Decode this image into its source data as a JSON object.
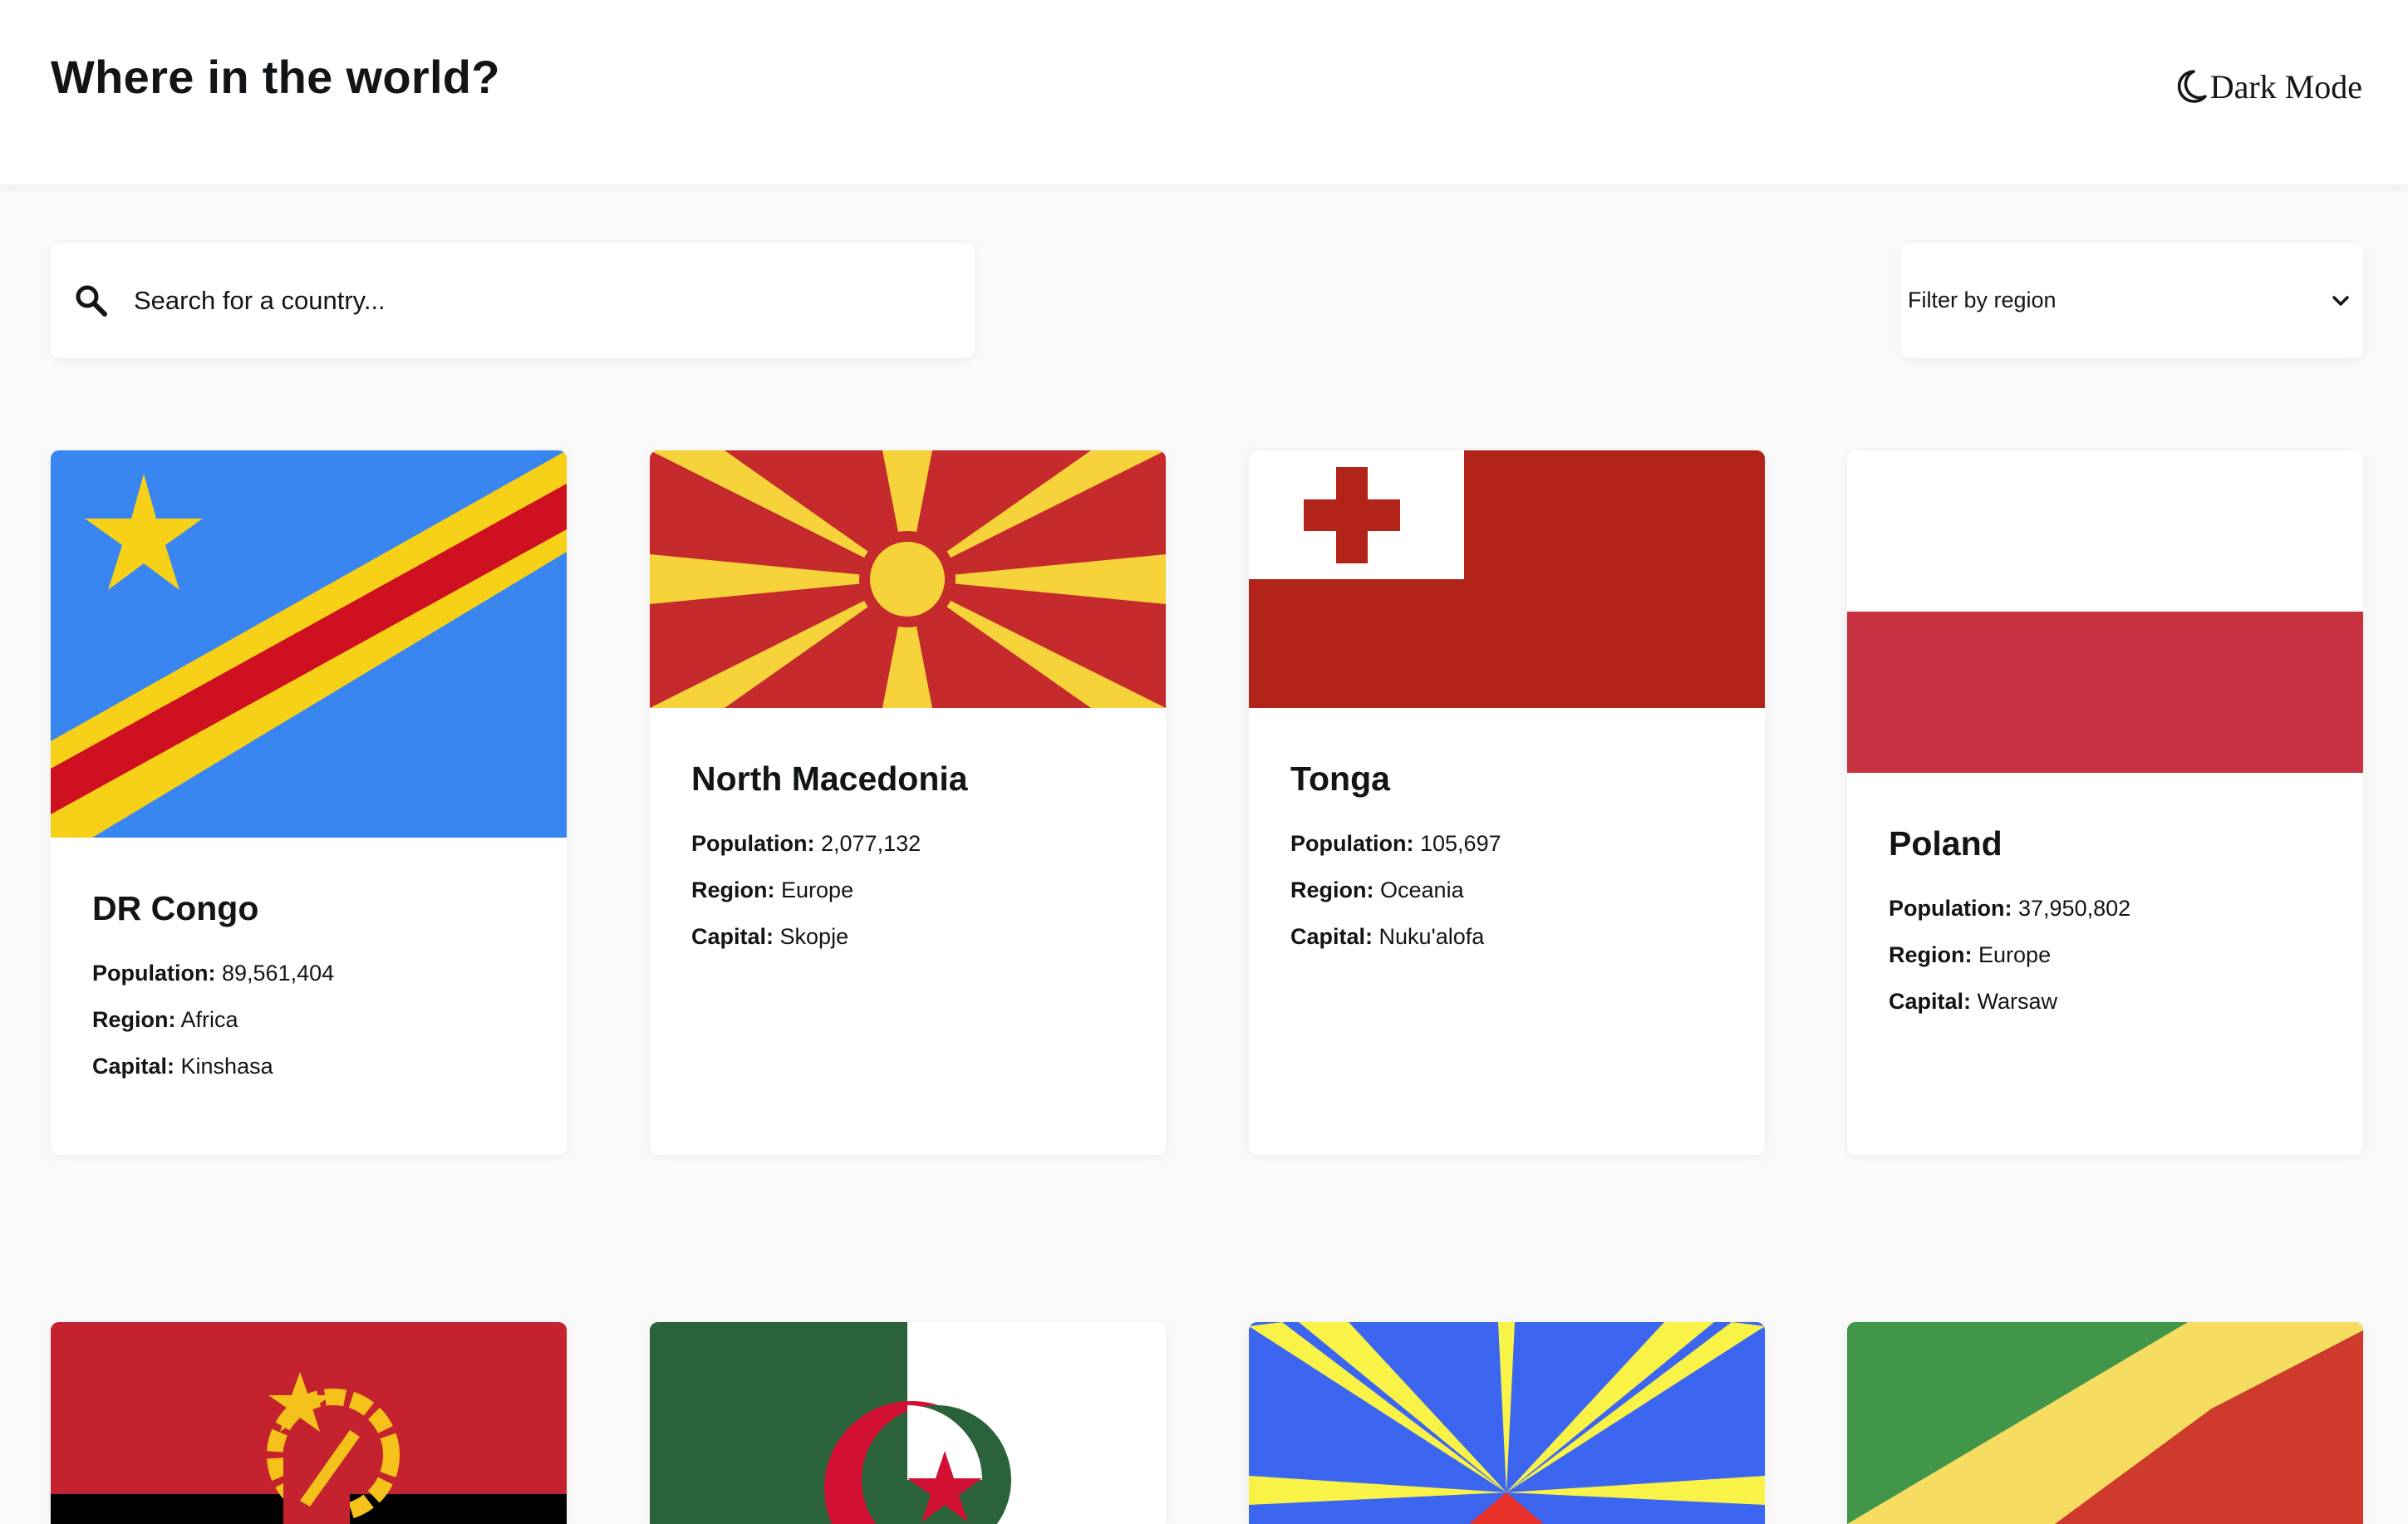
{
  "header": {
    "title": "Where in the world?",
    "mode_label": "Dark Mode",
    "mode_icon": "moon-icon"
  },
  "search": {
    "placeholder": "Search for a country...",
    "icon": "search-icon"
  },
  "filter": {
    "label": "Filter by region",
    "icon": "chevron-down-icon"
  },
  "labels": {
    "population": "Population:",
    "region": "Region:",
    "capital": "Capital:"
  },
  "countries": [
    {
      "name": "DR Congo",
      "population": "89,561,404",
      "region": "Africa",
      "capital": "Kinshasa"
    },
    {
      "name": "North Macedonia",
      "population": "2,077,132",
      "region": "Europe",
      "capital": "Skopje"
    },
    {
      "name": "Tonga",
      "population": "105,697",
      "region": "Oceania",
      "capital": "Nuku'alofa"
    },
    {
      "name": "Poland",
      "population": "37,950,802",
      "region": "Europe",
      "capital": "Warsaw"
    }
  ],
  "partial_flags": [
    "Angola",
    "Algeria",
    "Réunion",
    "Congo"
  ]
}
